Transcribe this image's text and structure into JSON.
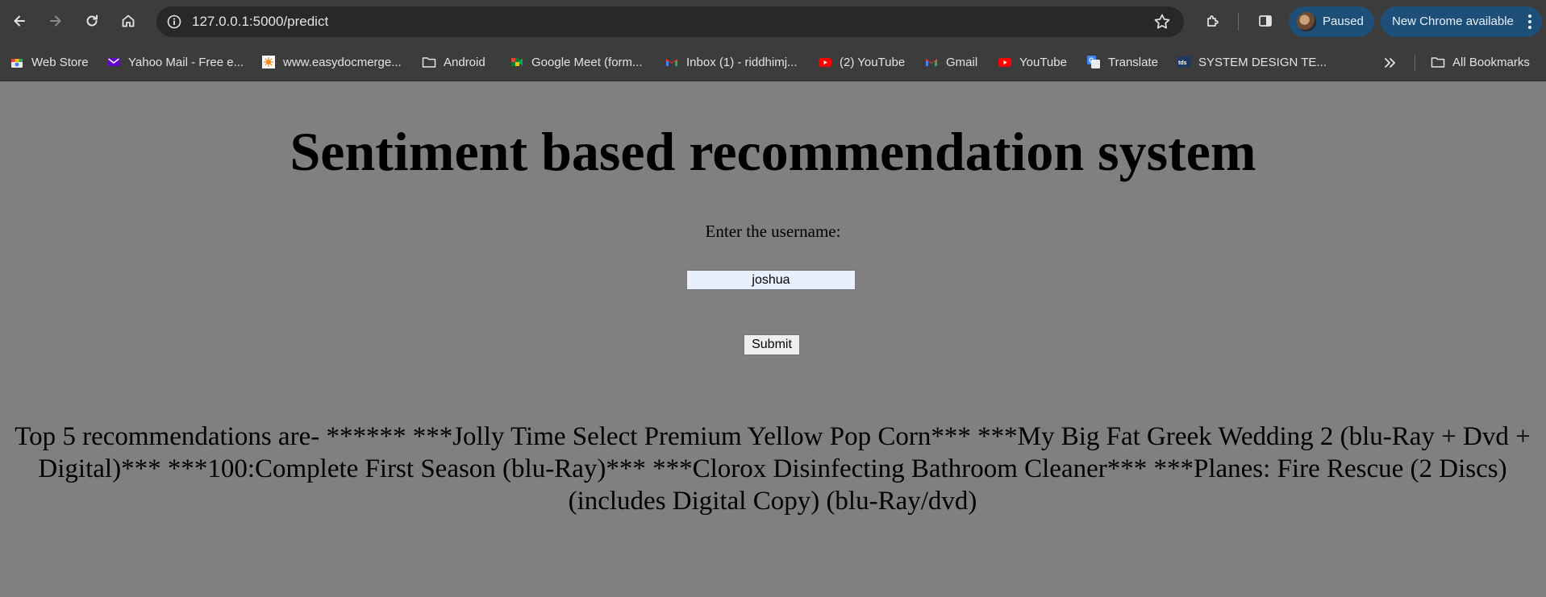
{
  "browser": {
    "url": "127.0.0.1:5000/predict",
    "profile_status": "Paused",
    "update_label": "New Chrome available",
    "accent_color": "#1d4f78"
  },
  "bookmarks": {
    "items": [
      {
        "label": "Web Store",
        "icon": "web-store-icon"
      },
      {
        "label": "Yahoo Mail - Free e...",
        "icon": "yahoo-mail-icon"
      },
      {
        "label": "www.easydocmerge...",
        "icon": "easydocmerge-icon"
      },
      {
        "label": "Android",
        "icon": "folder-icon"
      },
      {
        "label": "Google Meet (form...",
        "icon": "google-meet-icon"
      },
      {
        "label": "Inbox (1) - riddhimj...",
        "icon": "gmail-icon"
      },
      {
        "label": "(2) YouTube",
        "icon": "youtube-icon"
      },
      {
        "label": "Gmail",
        "icon": "gmail-icon"
      },
      {
        "label": "YouTube",
        "icon": "youtube-icon"
      },
      {
        "label": "Translate",
        "icon": "translate-icon"
      },
      {
        "label": "SYSTEM DESIGN TE...",
        "icon": "tds-icon"
      }
    ],
    "all_bookmarks_label": "All Bookmarks"
  },
  "page": {
    "background": "#808080",
    "title": "Sentiment based recommendation system",
    "prompt_label": "Enter the username:",
    "username_value": "joshua",
    "submit_label": "Submit",
    "recommendations_text": "Top 5 recommendations are- ****** ***Jolly Time Select Premium Yellow Pop Corn*** ***My Big Fat Greek Wedding 2 (blu-Ray + Dvd + Digital)*** ***100:Complete First Season (blu-Ray)*** ***Clorox Disinfecting Bathroom Cleaner*** ***Planes: Fire Rescue (2 Discs) (includes Digital Copy) (blu-Ray/dvd)"
  }
}
